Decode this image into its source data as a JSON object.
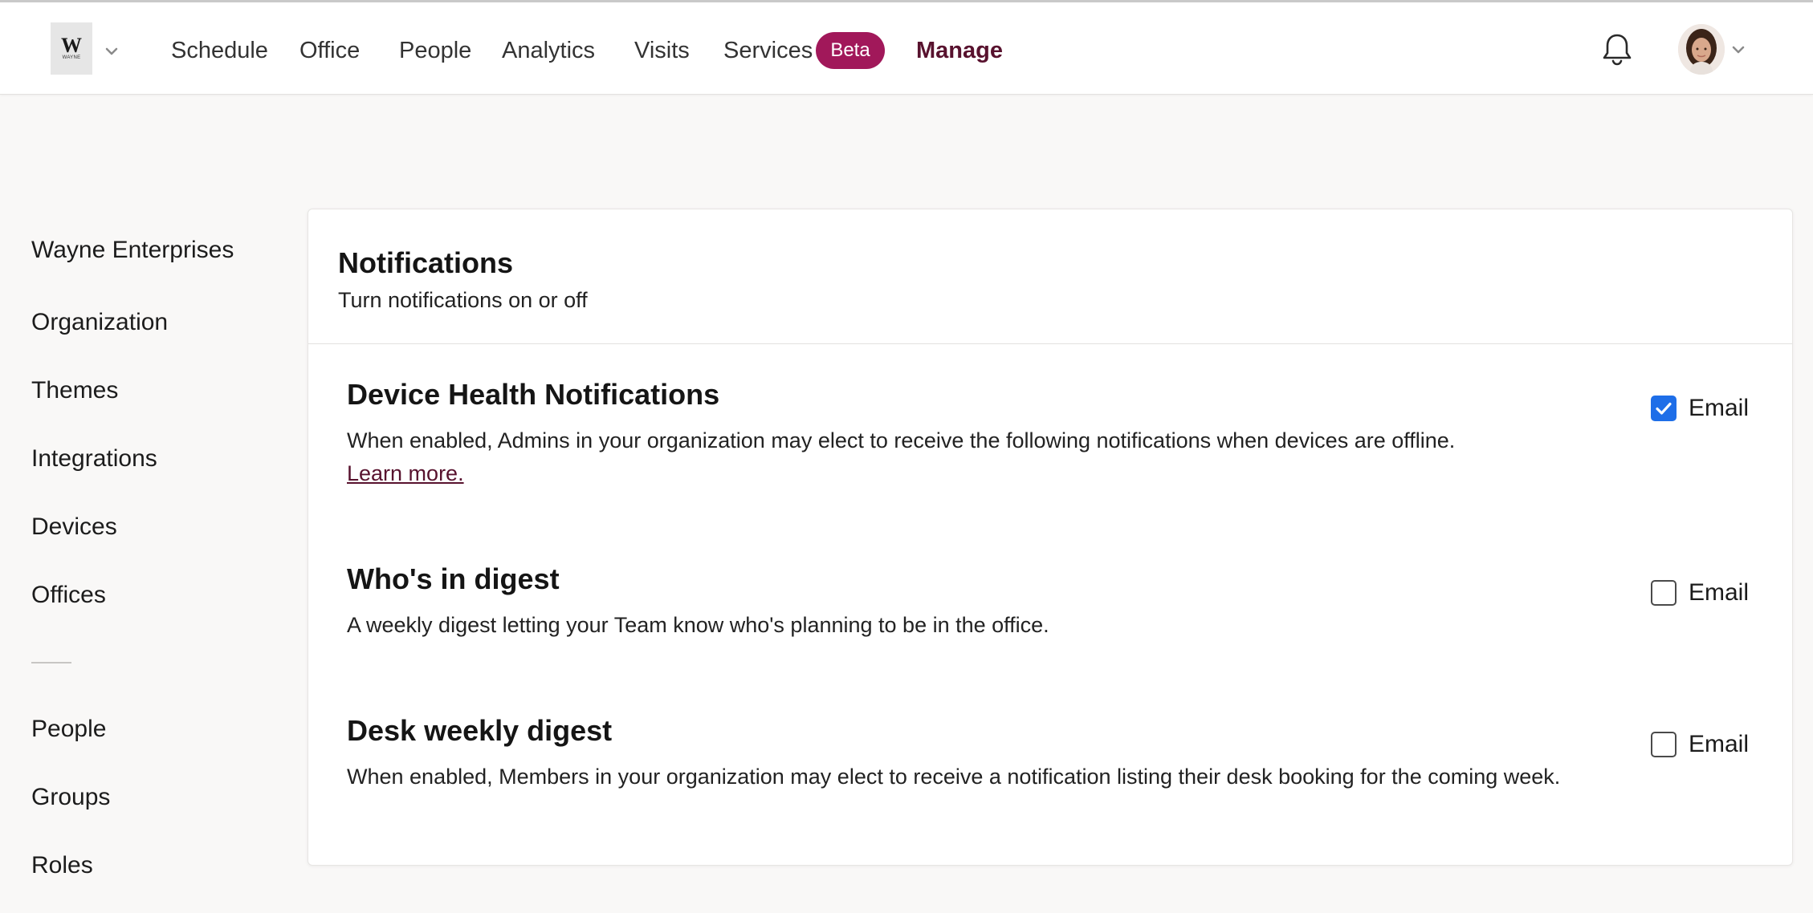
{
  "logo": {
    "letter": "W",
    "text": "WAYNE"
  },
  "nav": {
    "items": [
      {
        "label": "Schedule"
      },
      {
        "label": "Office"
      },
      {
        "label": "People"
      },
      {
        "label": "Analytics"
      },
      {
        "label": "Visits"
      },
      {
        "label": "Services"
      },
      {
        "label": "Manage"
      }
    ],
    "badge": "Beta",
    "active": "Manage"
  },
  "sidebar": {
    "items": [
      {
        "label": "Wayne Enterprises"
      },
      {
        "label": "Organization"
      },
      {
        "label": "Themes"
      },
      {
        "label": "Integrations"
      },
      {
        "label": "Devices"
      },
      {
        "label": "Offices"
      },
      {
        "label": "People"
      },
      {
        "label": "Groups"
      },
      {
        "label": "Roles"
      }
    ]
  },
  "card": {
    "title": "Notifications",
    "subtitle": "Turn notifications on or off",
    "settings": [
      {
        "title": "Device Health Notifications",
        "description": "When enabled, Admins in your organization may elect to receive the following notifications when devices are offline.",
        "link": "Learn more.",
        "option_label": "Email",
        "checked": true
      },
      {
        "title": "Who's in digest",
        "description": "A weekly digest letting your Team know who's planning to be in the office.",
        "option_label": "Email",
        "checked": false
      },
      {
        "title": "Desk weekly digest",
        "description": "When enabled, Members in your organization may elect to receive a notification listing their desk booking for the coming week.",
        "option_label": "Email",
        "checked": false
      }
    ]
  },
  "colors": {
    "brand": "#58122e",
    "badge": "#a1185a",
    "checkbox_checked": "#1e6ee8",
    "background": "#f9f8f7"
  }
}
